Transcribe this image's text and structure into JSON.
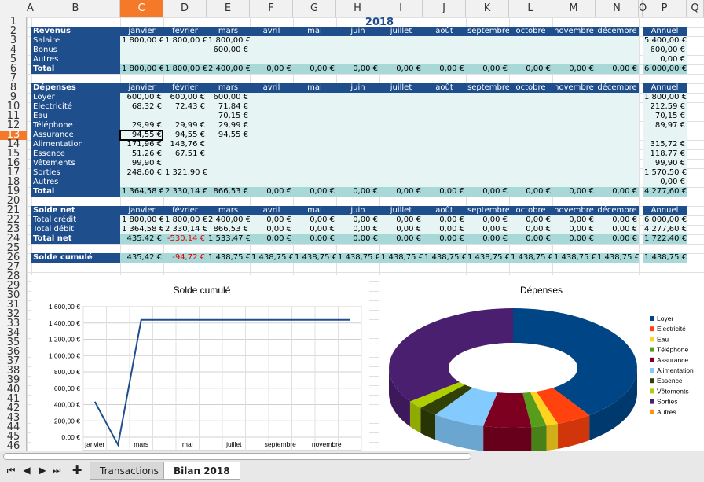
{
  "col_letters": [
    "A",
    "B",
    "C",
    "D",
    "E",
    "F",
    "G",
    "H",
    "I",
    "J",
    "K",
    "L",
    "M",
    "N",
    "O",
    "P",
    "Q"
  ],
  "selected_col": "C",
  "selected_row": "13",
  "year": "2018",
  "months": [
    "janvier",
    "février",
    "mars",
    "avril",
    "mai",
    "juin",
    "juillet",
    "août",
    "septembre",
    "octobre",
    "novembre",
    "décembre"
  ],
  "annual_label": "Annuel",
  "revenus": {
    "title": "Revenus",
    "rows": [
      {
        "label": "Salaire",
        "v": [
          "1 800,00 €",
          "1 800,00 €",
          "1 800,00 €",
          "",
          "",
          "",
          "",
          "",
          "",
          "",
          "",
          ""
        ],
        "a": "5 400,00 €"
      },
      {
        "label": "Bonus",
        "v": [
          "",
          "",
          "600,00 €",
          "",
          "",
          "",
          "",
          "",
          "",
          "",
          "",
          ""
        ],
        "a": "600,00 €"
      },
      {
        "label": "Autres",
        "v": [
          "",
          "",
          "",
          "",
          "",
          "",
          "",
          "",
          "",
          "",
          "",
          ""
        ],
        "a": "0,00 €"
      }
    ],
    "total": {
      "label": "Total",
      "v": [
        "1 800,00 €",
        "1 800,00 €",
        "2 400,00 €",
        "0,00 €",
        "0,00 €",
        "0,00 €",
        "0,00 €",
        "0,00 €",
        "0,00 €",
        "0,00 €",
        "0,00 €",
        "0,00 €"
      ],
      "a": "6 000,00 €"
    }
  },
  "depenses": {
    "title": "Dépenses",
    "rows": [
      {
        "label": "Loyer",
        "v": [
          "600,00 €",
          "600,00 €",
          "600,00 €",
          "",
          "",
          "",
          "",
          "",
          "",
          "",
          "",
          ""
        ],
        "a": "1 800,00 €"
      },
      {
        "label": "Electricité",
        "v": [
          "68,32 €",
          "72,43 €",
          "71,84 €",
          "",
          "",
          "",
          "",
          "",
          "",
          "",
          "",
          ""
        ],
        "a": "212,59 €"
      },
      {
        "label": "Eau",
        "v": [
          "",
          "",
          "70,15 €",
          "",
          "",
          "",
          "",
          "",
          "",
          "",
          "",
          ""
        ],
        "a": "70,15 €"
      },
      {
        "label": "Téléphone",
        "v": [
          "29,99 €",
          "29,99 €",
          "29,99 €",
          "",
          "",
          "",
          "",
          "",
          "",
          "",
          "",
          ""
        ],
        "a": "89,97 €"
      },
      {
        "label": "Assurance",
        "v": [
          "94,55 €",
          "94,55 €",
          "94,55 €",
          "",
          "",
          "",
          "",
          "",
          "",
          "",
          "",
          ""
        ],
        "a": ""
      },
      {
        "label": "Alimentation",
        "v": [
          "171,96 €",
          "143,76 €",
          "",
          "",
          "",
          "",
          "",
          "",
          "",
          "",
          "",
          ""
        ],
        "a": "315,72 €"
      },
      {
        "label": "Essence",
        "v": [
          "51,26 €",
          "67,51 €",
          "",
          "",
          "",
          "",
          "",
          "",
          "",
          "",
          "",
          ""
        ],
        "a": "118,77 €"
      },
      {
        "label": "Vêtements",
        "v": [
          "99,90 €",
          "",
          "",
          "",
          "",
          "",
          "",
          "",
          "",
          "",
          "",
          ""
        ],
        "a": "99,90 €"
      },
      {
        "label": "Sorties",
        "v": [
          "248,60 €",
          "1 321,90 €",
          "",
          "",
          "",
          "",
          "",
          "",
          "",
          "",
          "",
          ""
        ],
        "a": "1 570,50 €"
      },
      {
        "label": "Autres",
        "v": [
          "",
          "",
          "",
          "",
          "",
          "",
          "",
          "",
          "",
          "",
          "",
          ""
        ],
        "a": "0,00 €"
      }
    ],
    "total": {
      "label": "Total",
      "v": [
        "1 364,58 €",
        "2 330,14 €",
        "866,53 €",
        "0,00 €",
        "0,00 €",
        "0,00 €",
        "0,00 €",
        "0,00 €",
        "0,00 €",
        "0,00 €",
        "0,00 €",
        "0,00 €"
      ],
      "a": "4 277,60 €"
    }
  },
  "solde": {
    "title": "Solde net",
    "rows": [
      {
        "label": "Total crédit",
        "v": [
          "1 800,00 €",
          "1 800,00 €",
          "2 400,00 €",
          "0,00 €",
          "0,00 €",
          "0,00 €",
          "0,00 €",
          "0,00 €",
          "0,00 €",
          "0,00 €",
          "0,00 €",
          "0,00 €"
        ],
        "a": "6 000,00 €"
      },
      {
        "label": "Total débit",
        "v": [
          "1 364,58 €",
          "2 330,14 €",
          "866,53 €",
          "0,00 €",
          "0,00 €",
          "0,00 €",
          "0,00 €",
          "0,00 €",
          "0,00 €",
          "0,00 €",
          "0,00 €",
          "0,00 €"
        ],
        "a": "4 277,60 €"
      }
    ],
    "total": {
      "label": "Total net",
      "v": [
        "435,42 €",
        "-530,14 €",
        "1 533,47 €",
        "0,00 €",
        "0,00 €",
        "0,00 €",
        "0,00 €",
        "0,00 €",
        "0,00 €",
        "0,00 €",
        "0,00 €",
        "0,00 €"
      ],
      "a": "1 722,40 €"
    }
  },
  "cumule": {
    "label": "Solde cumulé",
    "v": [
      "435,42 €",
      "-94,72 €",
      "1 438,75 €",
      "1 438,75 €",
      "1 438,75 €",
      "1 438,75 €",
      "1 438,75 €",
      "1 438,75 €",
      "1 438,75 €",
      "1 438,75 €",
      "1 438,75 €",
      "1 438,75 €"
    ],
    "a": "1 438,75 €"
  },
  "chart_data": [
    {
      "type": "line",
      "title": "Solde cumulé",
      "x": [
        "janvier",
        "février",
        "mars",
        "avril",
        "mai",
        "juin",
        "juillet",
        "août",
        "septembre",
        "octobre",
        "novembre",
        "décembre"
      ],
      "xtick_labels": [
        "janvier",
        "mars",
        "mai",
        "juillet",
        "septembre",
        "novembre"
      ],
      "values": [
        435.42,
        -94.72,
        1438.75,
        1438.75,
        1438.75,
        1438.75,
        1438.75,
        1438.75,
        1438.75,
        1438.75,
        1438.75,
        1438.75
      ],
      "ylim": [
        0,
        1600
      ],
      "yticks": [
        "0,00 €",
        "200,00 €",
        "400,00 €",
        "600,00 €",
        "800,00 €",
        "1 000,00 €",
        "1 200,00 €",
        "1 400,00 €",
        "1 600,00 €"
      ],
      "color": "#1f4e8c",
      "grid": true
    },
    {
      "type": "pie",
      "title": "Dépenses",
      "style": "3D donut",
      "legend_position": "right",
      "categories": [
        "Loyer",
        "Electricité",
        "Eau",
        "Téléphone",
        "Assurance",
        "Alimentation",
        "Essence",
        "Vêtements",
        "Sorties",
        "Autres"
      ],
      "values": [
        1800,
        212.59,
        70.15,
        89.97,
        283.65,
        315.72,
        118.77,
        99.9,
        1570.5,
        0
      ],
      "colors": [
        "#004586",
        "#ff420e",
        "#ffd320",
        "#579d1c",
        "#7e0021",
        "#83caff",
        "#314004",
        "#aecf00",
        "#4b1f6f",
        "#ff950e"
      ]
    }
  ],
  "tabs": {
    "sheet1": "Transactions",
    "sheet2": "Bilan 2018"
  }
}
